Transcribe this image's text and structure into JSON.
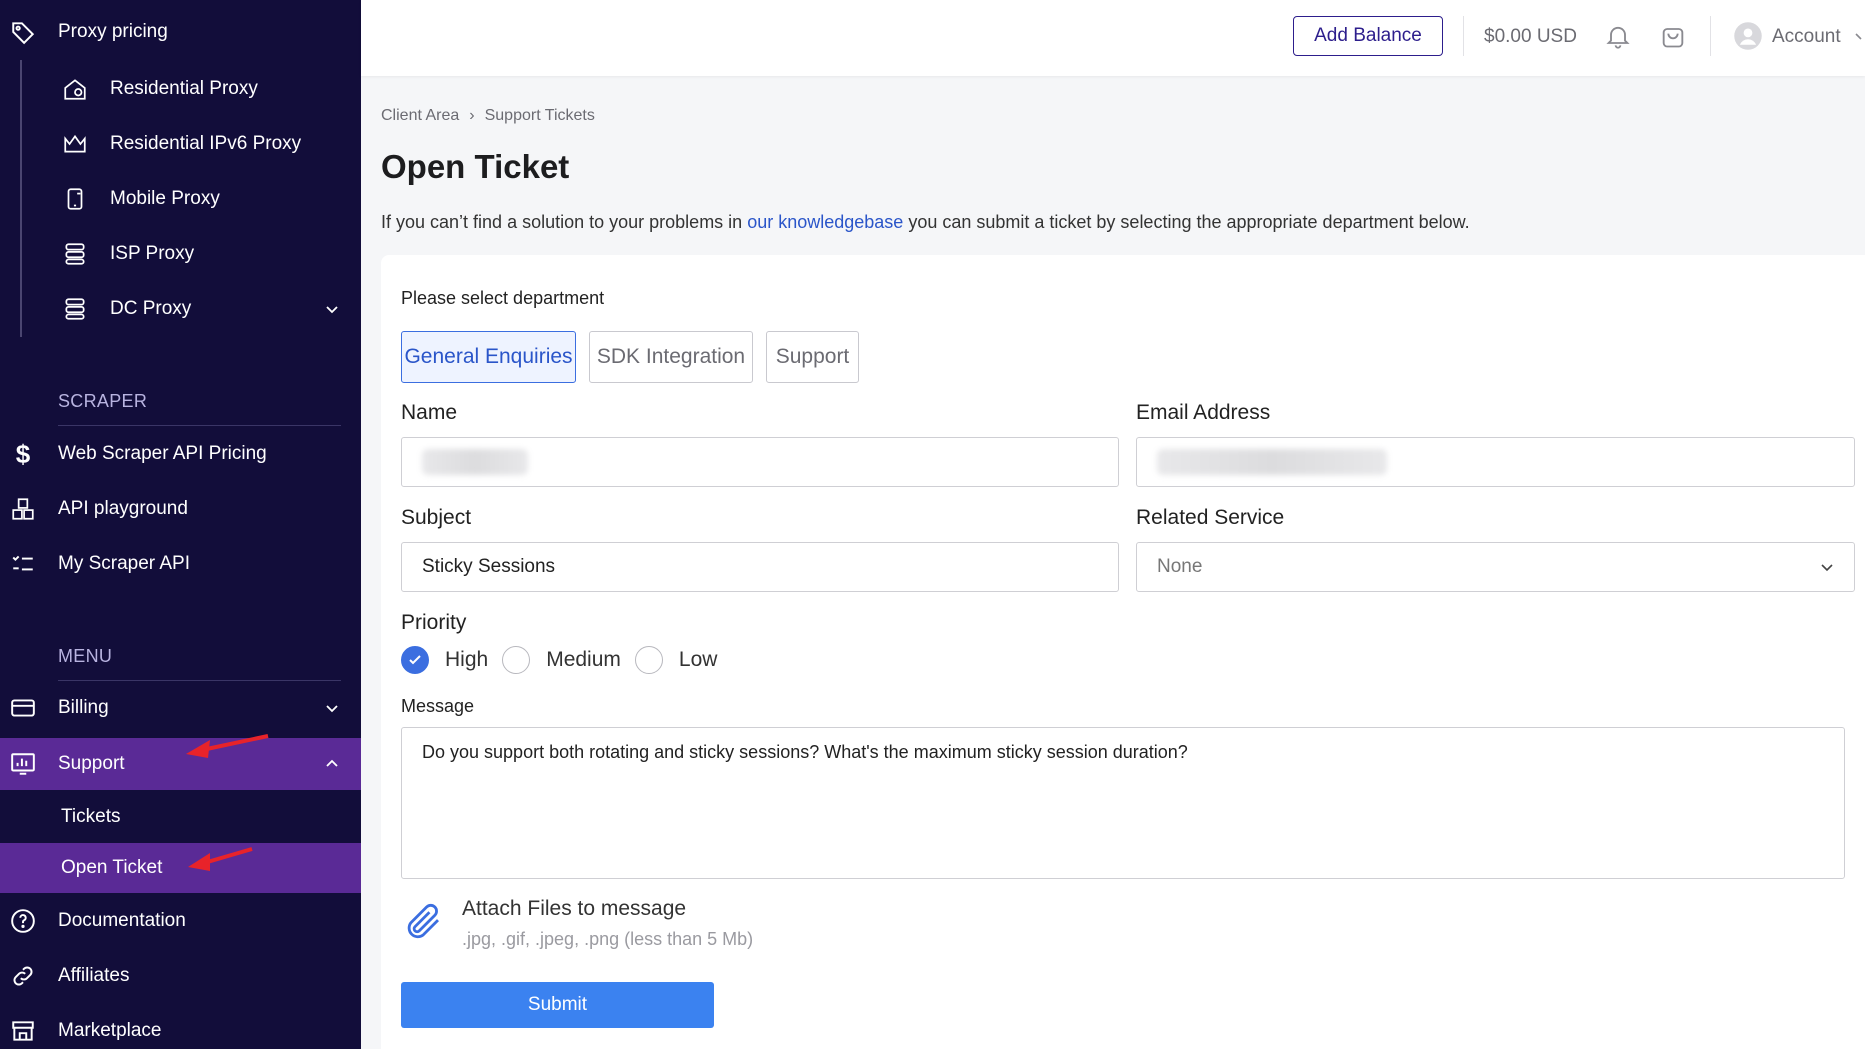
{
  "sidebar": {
    "proxy_pricing": "Proxy pricing",
    "proxy_items": [
      "Residential Proxy",
      "Residential IPv6 Proxy",
      "Mobile Proxy",
      "ISP Proxy",
      "DC Proxy"
    ],
    "scraper_heading": "SCRAPER",
    "scraper_items": [
      "Web Scraper API Pricing",
      "API playground",
      "My Scraper API"
    ],
    "menu_heading": "MENU",
    "menu_items": [
      "Billing",
      "Support"
    ],
    "support_children": [
      "Tickets",
      "Open Ticket"
    ],
    "bottom_items": [
      "Documentation",
      "Affiliates",
      "Marketplace"
    ],
    "active_item": "Support",
    "active_child": "Open Ticket",
    "colors": {
      "background": "#120d3a",
      "active": "#5a2a96",
      "arrow": "#e8232a"
    }
  },
  "topbar": {
    "add_balance": "Add Balance",
    "balance": "$0.00 USD",
    "account": "Account",
    "icons": [
      "bell-icon",
      "cart-icon",
      "user-avatar-icon"
    ]
  },
  "breadcrumb": {
    "items": [
      "Client Area",
      "Support Tickets"
    ],
    "separator": "›"
  },
  "page": {
    "title": "Open Ticket",
    "intro_before": "If you can’t find a solution to your problems in ",
    "intro_link": "our knowledgebase",
    "intro_after": " you can submit a ticket by selecting the appropriate department below."
  },
  "form": {
    "department_label": "Please select department",
    "departments": [
      "General Enquiries",
      "SDK Integration",
      "Support"
    ],
    "selected_department": "General Enquiries",
    "name_label": "Name",
    "email_label": "Email Address",
    "subject_label": "Subject",
    "subject_value": "Sticky Sessions",
    "related_label": "Related Service",
    "related_value": "None",
    "priority_label": "Priority",
    "priorities": [
      "High",
      "Medium",
      "Low"
    ],
    "selected_priority": "High",
    "message_label": "Message",
    "message_value": "Do you support both rotating and sticky sessions? What's the maximum sticky session duration?",
    "attach_title": "Attach Files to message",
    "attach_hint": ".jpg, .gif, .jpeg, .png (less than 5 Mb)",
    "submit_label": "Submit",
    "accent": "#3b6ee0"
  }
}
